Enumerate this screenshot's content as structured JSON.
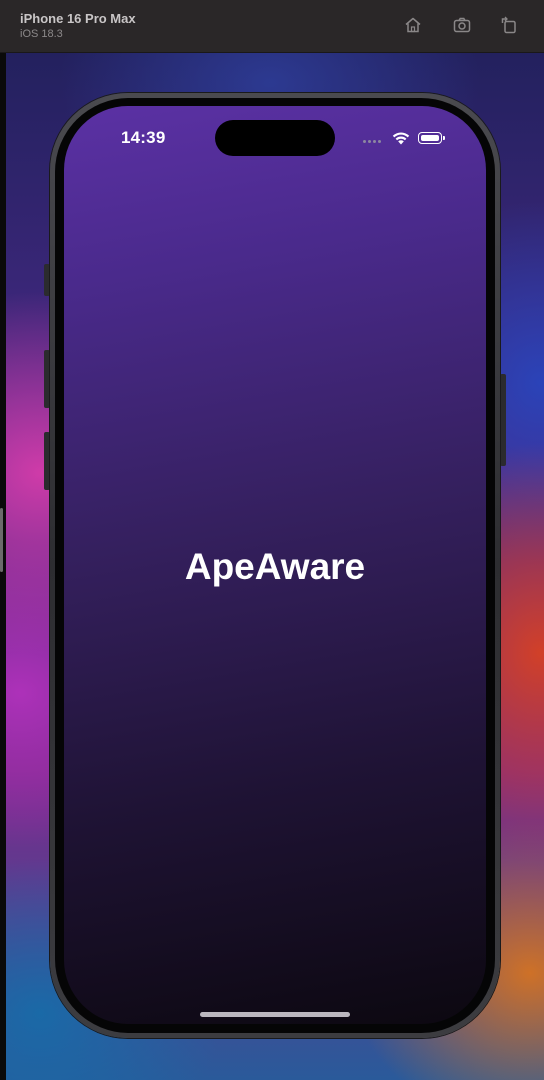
{
  "simulator": {
    "device_name": "iPhone 16 Pro Max",
    "os_version": "iOS 18.3",
    "toolbar_icons": [
      "home-icon",
      "screenshot-icon",
      "rotate-icon"
    ]
  },
  "status_bar": {
    "time": "14:39",
    "icons": [
      "cellular-dots-icon",
      "wifi-icon",
      "battery-icon"
    ]
  },
  "app": {
    "title": "ApeAware"
  },
  "colors": {
    "screen_gradient_top": "#5b31a4",
    "screen_gradient_bottom": "#0c0810",
    "title_text": "#ffffff"
  }
}
